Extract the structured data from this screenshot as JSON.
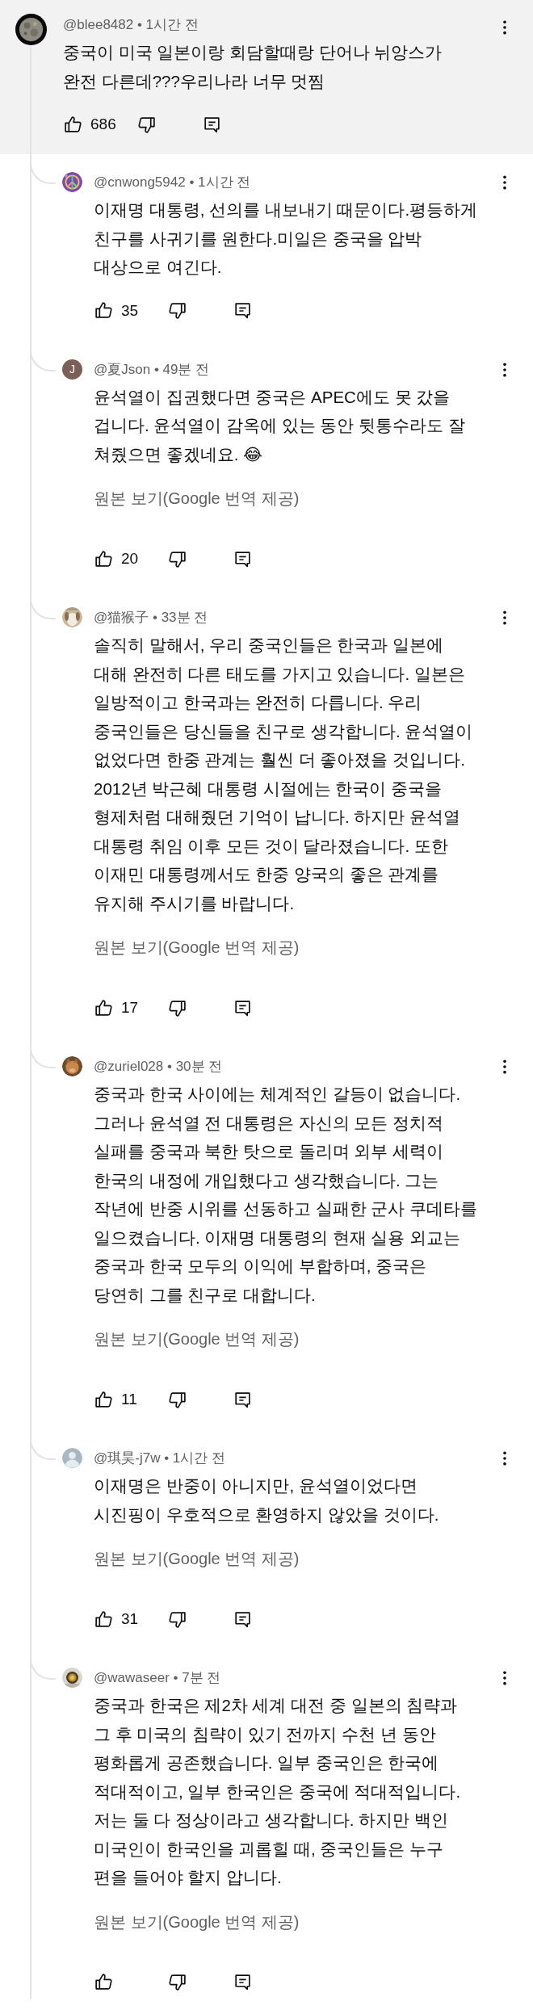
{
  "comment": {
    "meta": "@blee8482 • 1시간 전",
    "text": "중국이 미국 일본이랑 회담할때랑 단어나 뉘앙스가\n완전 다른데???우리나라 너무 멋찜",
    "likes": "686"
  },
  "replies": [
    {
      "meta": "@cnwong5942 • 1시간 전",
      "text": "이재명 대통령, 선의를 내보내기 때문이다.평등하게\n친구를 사귀기를 원한다.미일은 중국을 압박\n대상으로 여긴다.",
      "likes": "35"
    },
    {
      "avatar": {
        "kind": "letter",
        "letter": "J"
      },
      "meta": "@夏Json • 49분 전",
      "text": "윤석열이 집권했다면 중국은 APEC에도 못 갔을\n겁니다. 윤석열이 감옥에 있는 동안 뒷통수라도 잘\n쳐줬으면 좋겠네요. 😂",
      "translate_link": "원본 보기(Google 번역 제공)",
      "likes": "20"
    },
    {
      "meta": "@猫猴子 • 33분 전",
      "text": "솔직히 말해서, 우리 중국인들은 한국과 일본에\n대해 완전히 다른 태도를 가지고 있습니다. 일본은\n일방적이고 한국과는 완전히 다릅니다. 우리\n중국인들은 당신들을 친구로 생각합니다. 윤석열이\n없었다면 한중 관계는 훨씬 더 좋아졌을 것입니다.\n2012년 박근혜 대통령 시절에는 한국이 중국을\n형제처럼 대해줬던 기억이 납니다. 하지만 윤석열\n대통령 취임 이후 모든 것이 달라졌습니다. 또한\n이재민 대통령께서도 한중 양국의 좋은 관계를\n유지해 주시기를 바랍니다.",
      "translate_link": "원본 보기(Google 번역 제공)",
      "likes": "17"
    },
    {
      "meta": "@zuriel028 • 30분 전",
      "text": "중국과 한국 사이에는 체계적인 갈등이 없습니다.\n그러나 윤석열 전 대통령은 자신의 모든 정치적\n실패를 중국과 북한 탓으로 돌리며 외부 세력이\n한국의 내정에 개입했다고 생각했습니다. 그는\n작년에 반중 시위를 선동하고 실패한 군사 쿠데타를\n일으켰습니다. 이재명 대통령의 현재 실용 외교는\n중국과 한국 모두의 이익에 부합하며, 중국은\n당연히 그를 친구로 대합니다.",
      "translate_link": "원본 보기(Google 번역 제공)",
      "likes": "11"
    },
    {
      "avatar": {
        "kind": "default"
      },
      "meta": "@琪昊-j7w • 1시간 전",
      "text": "이재명은 반중이 아니지만, 윤석열이었다면\n시진핑이 우호적으로 환영하지 않았을 것이다.",
      "translate_link": "원본 보기(Google 번역 제공)",
      "likes": "31"
    },
    {
      "meta": "@wawaseer • 7분 전",
      "text": "중국과 한국은 제2차 세계 대전 중 일본의 침략과\n그 후 미국의 침략이 있기 전까지 수천 년 동안\n평화롭게 공존했습니다. 일부 중국인은 한국에\n적대적이고, 일부 한국인은 중국에 적대적입니다.\n저는 둘 다 정상이라고 생각합니다. 하지만 백인\n미국인이 한국인을 괴롭힐 때, 중국인들은 누구\n편을 들어야 할지 압니다.",
      "translate_link": "원본 보기(Google 번역 제공)"
    }
  ]
}
